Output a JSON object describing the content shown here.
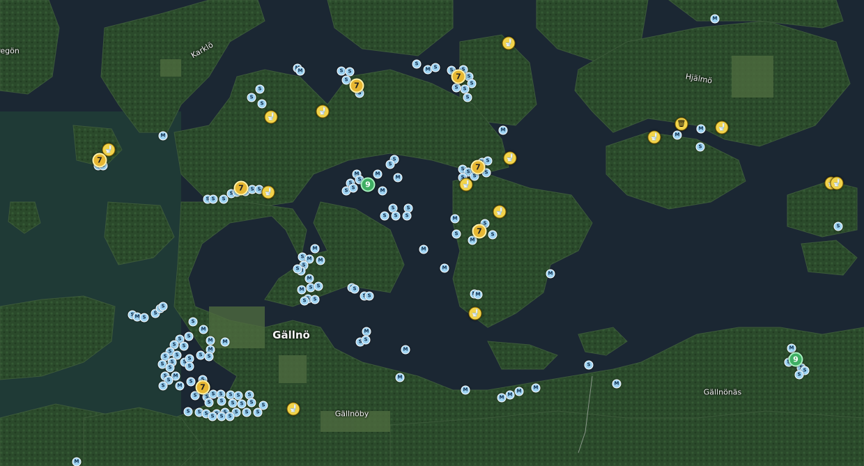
{
  "map": {
    "labels": {
      "karklo": "Karklö",
      "hjalmo": "Hjälmö",
      "galno": "Gällnö",
      "gallnoby": "Gällnöby",
      "gallnonas": "Gällnönäs",
      "regon": "regön"
    },
    "pin_letters": {
      "mooring": "M",
      "service": "S"
    },
    "clusters": [
      {
        "label": "7",
        "color": "yellow"
      },
      {
        "label": "9",
        "color": "green"
      }
    ],
    "poi_icons": [
      "toilet-icon",
      "trash-icon"
    ],
    "colors": {
      "water": "#1b2733",
      "land": "#2d4a2c",
      "pin": "#9fd4f3",
      "toilet": "#f2d34b",
      "cluster_green": "#3fae63"
    }
  }
}
